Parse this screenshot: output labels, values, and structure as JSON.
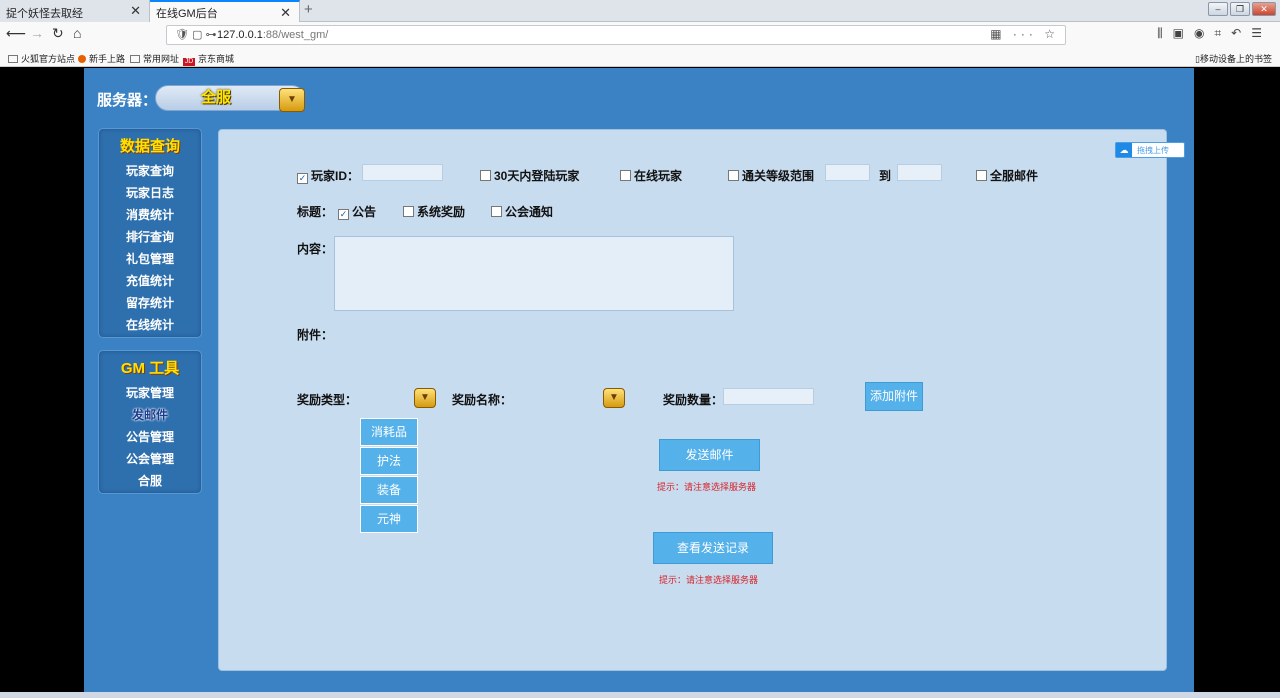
{
  "browser": {
    "tabs": [
      {
        "label": "捉个妖怪去取经"
      },
      {
        "label": "在线GM后台"
      }
    ],
    "url_host": "127.0.0.1",
    "url_path": ":88/west_gm/",
    "bookmarks": [
      {
        "label": "火狐官方站点"
      },
      {
        "label": "新手上路"
      },
      {
        "label": "常用网址"
      },
      {
        "label": "京东商城"
      }
    ],
    "mobile_bookmarks": "移动设备上的书签"
  },
  "header": {
    "server_label": "服务器：",
    "server_value": "全服"
  },
  "sidebar": {
    "query_title": "数据查询",
    "query_items": [
      {
        "label": "玩家查询"
      },
      {
        "label": "玩家日志"
      },
      {
        "label": "消费统计"
      },
      {
        "label": "排行查询"
      },
      {
        "label": "礼包管理"
      },
      {
        "label": "充值统计"
      },
      {
        "label": "留存统计"
      },
      {
        "label": "在线统计"
      }
    ],
    "gm_title": "GM 工具",
    "gm_items": [
      {
        "label": "玩家管理"
      },
      {
        "label": "发邮件"
      },
      {
        "label": "公告管理"
      },
      {
        "label": "公会管理"
      },
      {
        "label": "合服"
      }
    ]
  },
  "form": {
    "player_id_label": "玩家ID：",
    "login30_label": "30天内登陆玩家",
    "online_label": "在线玩家",
    "level_range_label": "通关等级范围",
    "to_label": "到",
    "all_mail_label": "全服邮件",
    "title_label": "标题：",
    "title_options": [
      {
        "label": "公告",
        "checked": true
      },
      {
        "label": "系统奖励",
        "checked": false
      },
      {
        "label": "公会通知",
        "checked": false
      }
    ],
    "content_label": "内容：",
    "attachment_label": "附件：",
    "reward_type_label": "奖励类型：",
    "reward_name_label": "奖励名称：",
    "reward_count_label": "奖励数量：",
    "add_attachment": "添加附件",
    "reward_types": [
      {
        "label": "消耗品"
      },
      {
        "label": "护法"
      },
      {
        "label": "装备"
      },
      {
        "label": "元神"
      }
    ],
    "send_mail": "发送邮件",
    "send_hint": "提示：请注意选择服务器",
    "view_records": "查看发送记录",
    "records_hint": "提示：请注意选择服务器",
    "upload_label": "拖拽上传"
  },
  "colors": {
    "page_bg": "#3a82c4",
    "panel_bg": "#c8dcef",
    "button_blue": "#55b1ea",
    "title_yellow": "#ffe200",
    "hint_red": "#d6232a"
  }
}
